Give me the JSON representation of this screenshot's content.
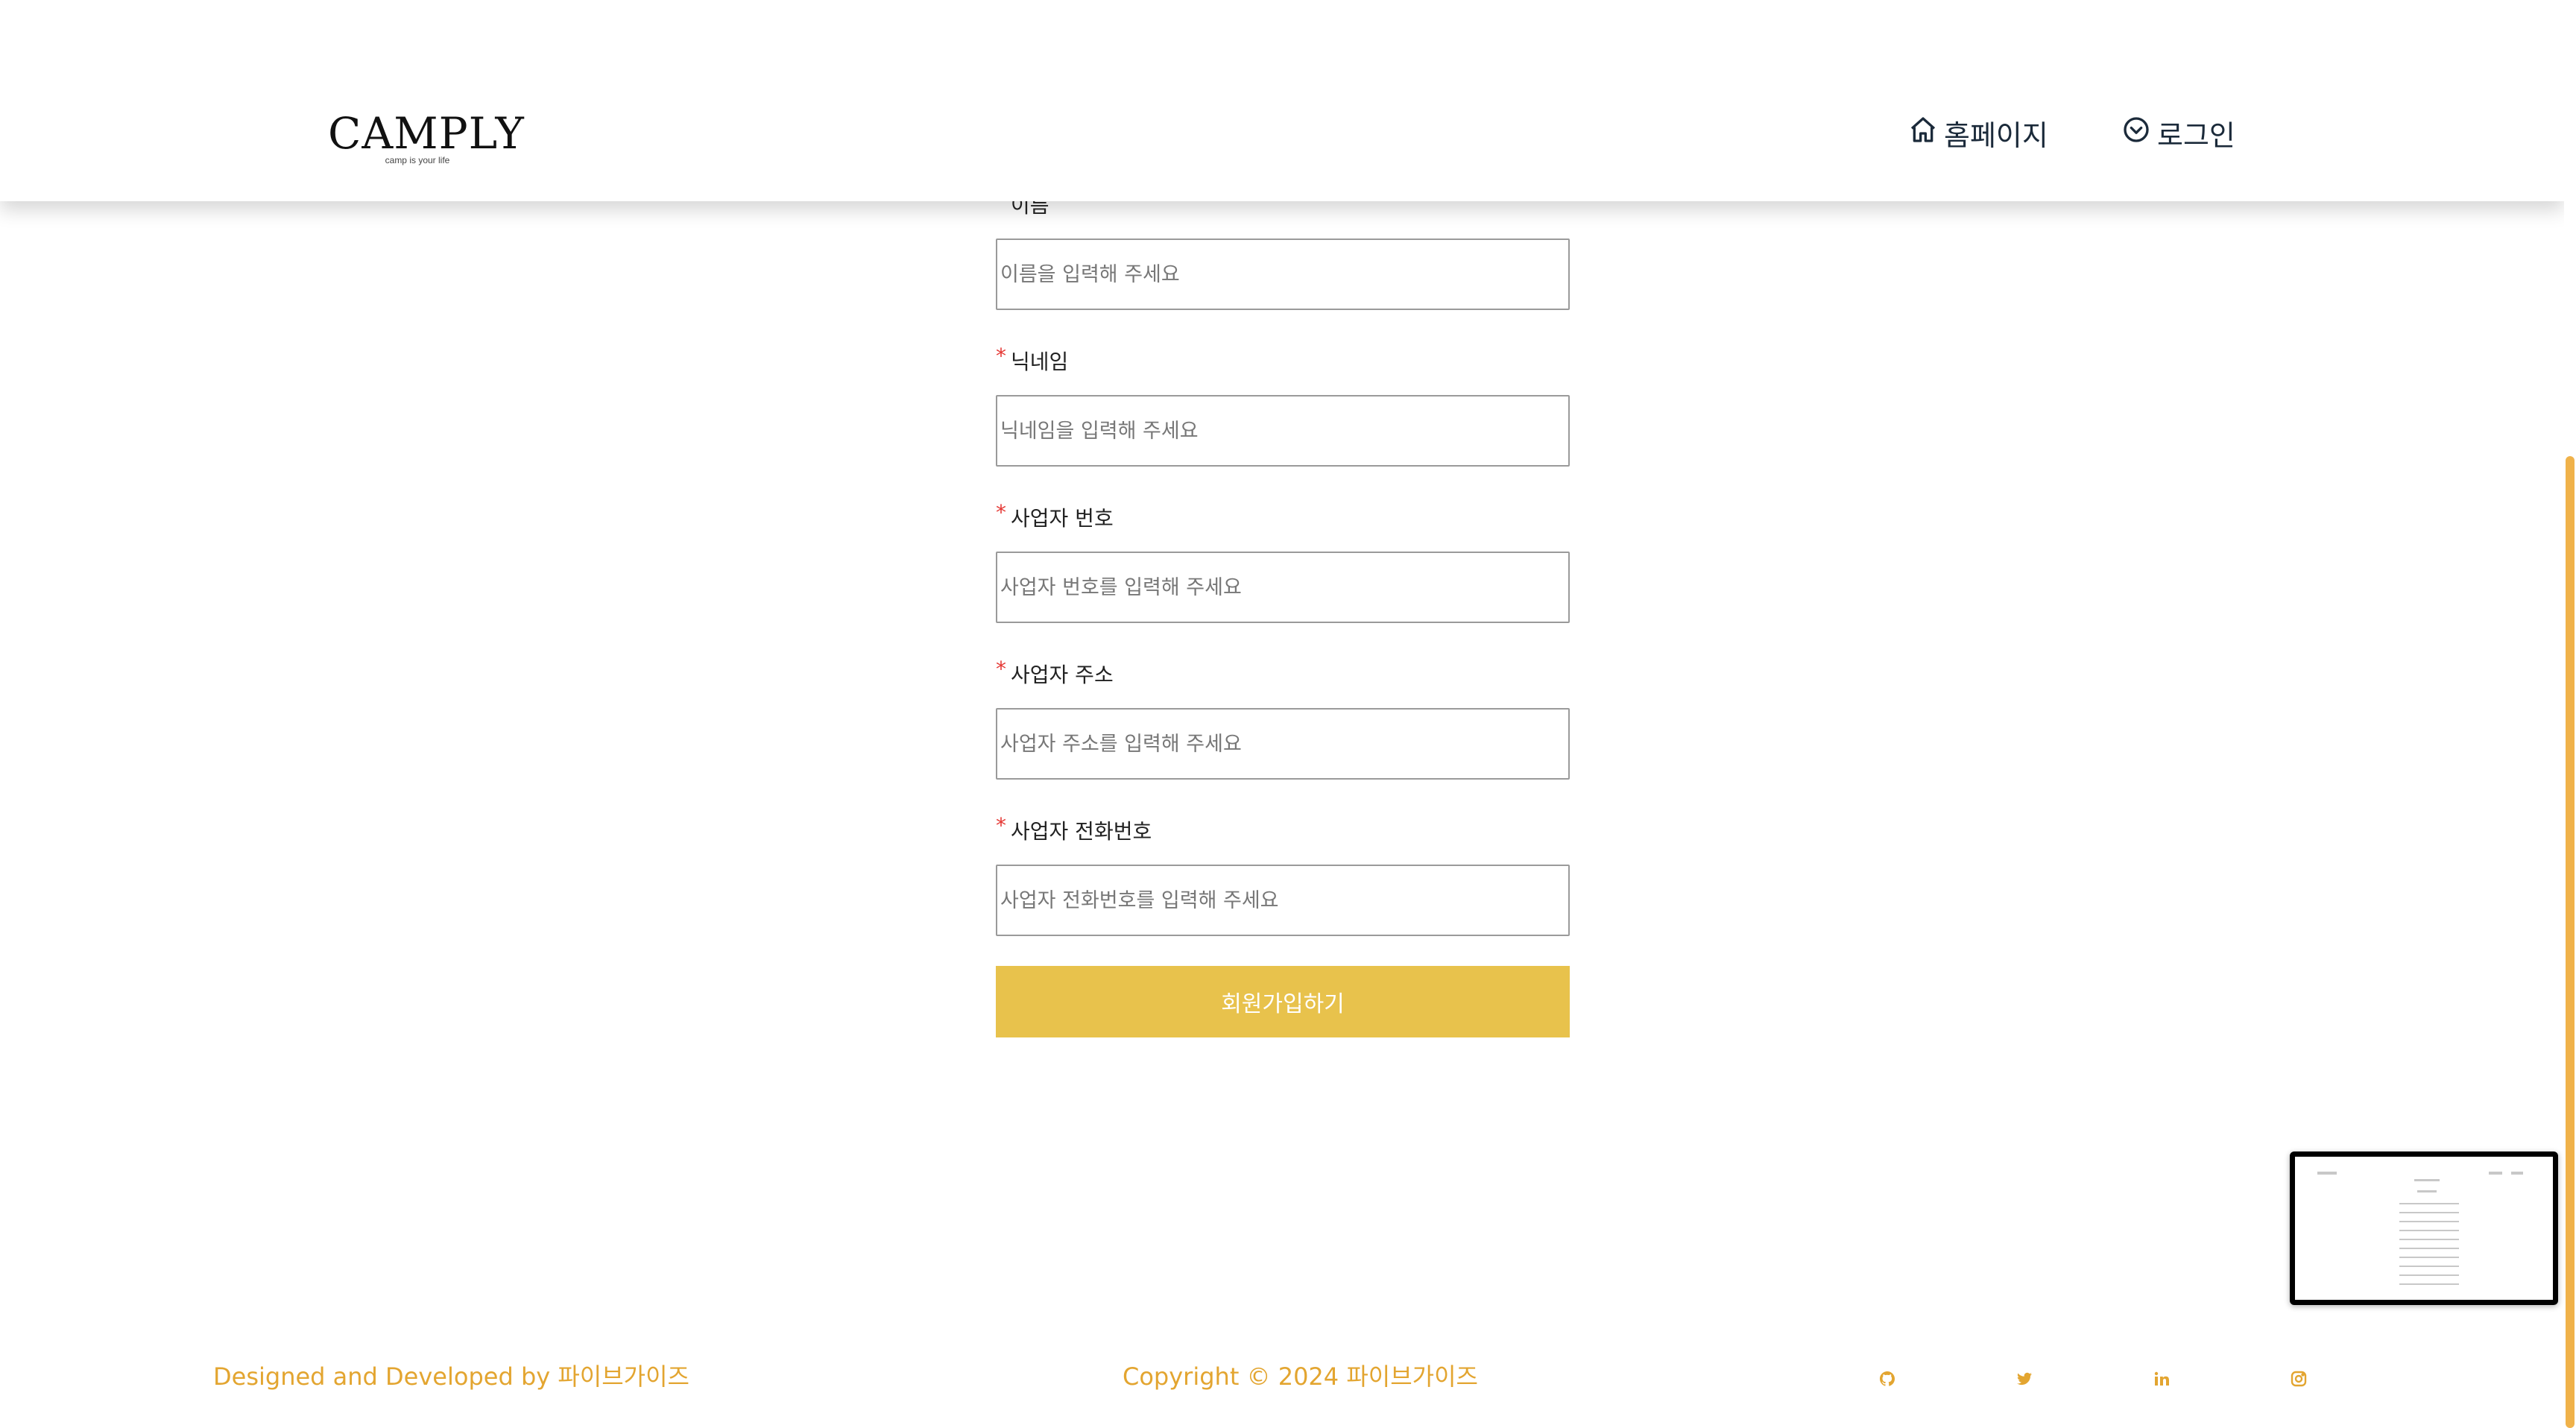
{
  "header": {
    "logo_text": "CAMPLY",
    "logo_tagline": "camp is your life",
    "nav": {
      "home_label": "홈페이지",
      "home_icon": "home-icon",
      "login_label": "로그인",
      "login_icon": "chevron-circle-down-icon"
    }
  },
  "form": {
    "required_mark": "*",
    "fields": [
      {
        "label": "이름",
        "placeholder": "이름을 입력해 주세요"
      },
      {
        "label": "닉네임",
        "placeholder": "닉네임을 입력해 주세요"
      },
      {
        "label": "사업자 번호",
        "placeholder": "사업자 번호를 입력해 주세요"
      },
      {
        "label": "사업자 주소",
        "placeholder": "사업자 주소를 입력해 주세요"
      },
      {
        "label": "사업자 전화번호",
        "placeholder": "사업자 전화번호를 입력해 주세요"
      }
    ],
    "submit_label": "회원가입하기"
  },
  "footer": {
    "left_text": "Designed and Developed by 파이브가이즈",
    "center_text": "Copyright © 2024 파이브가이즈",
    "social_icons": [
      "github-icon",
      "twitter-icon",
      "linkedin-icon",
      "instagram-icon"
    ]
  },
  "colors": {
    "accent": "#e8c24c",
    "footer_text": "#e3a530",
    "required": "#e53935",
    "scrollbar": "#f0b24a"
  }
}
